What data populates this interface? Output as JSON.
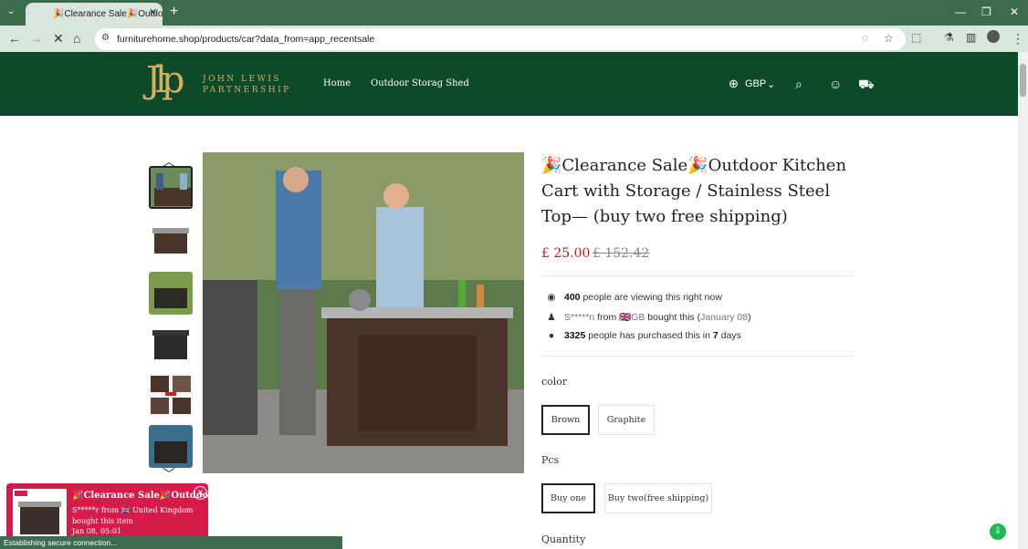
{
  "browser": {
    "tab_title": "🎉Clearance Sale🎉Outdoor K",
    "url": "furniturehome.shop/products/car?data_from=app_recentsale",
    "status": "Establishing secure connection..."
  },
  "header": {
    "logo_mark": "Jlp",
    "logo_line1": "JOHN LEWIS",
    "logo_line2": "PARTNERSHIP",
    "nav": [
      "Home",
      "Outdoor Storag Shed"
    ],
    "currency": "GBP"
  },
  "product": {
    "title": "🎉Clearance Sale🎉Outdoor Kitchen Cart with Storage / Stainless Steel Top— (buy two free shipping)",
    "price": "£ 25.00",
    "old_price": "£ 152.42",
    "viewing_count": "400",
    "viewing_text": "people are viewing this right now",
    "buyer_name": "S*****n",
    "buyer_from": "from",
    "buyer_country": "🇬🇧GB",
    "buyer_action": "bought this (",
    "buyer_date": "January 08",
    "buyer_close": ")",
    "purchased_count": "3325",
    "purchased_text": "people has purchased this in",
    "purchased_days": "7",
    "purchased_unit": "days",
    "color_label": "color",
    "colors": [
      "Brown",
      "Graphite"
    ],
    "pcs_label": "Pcs",
    "pcs": [
      "Buy one",
      "Buy two(free shipping)"
    ],
    "quantity_label": "Quantity"
  },
  "popup": {
    "title": "🎉Clearance Sale🎉Outdoor K...",
    "text": "S*****r from 🇬🇧 United Kingdom bought this item",
    "time": "Jan 08, 05:01"
  }
}
